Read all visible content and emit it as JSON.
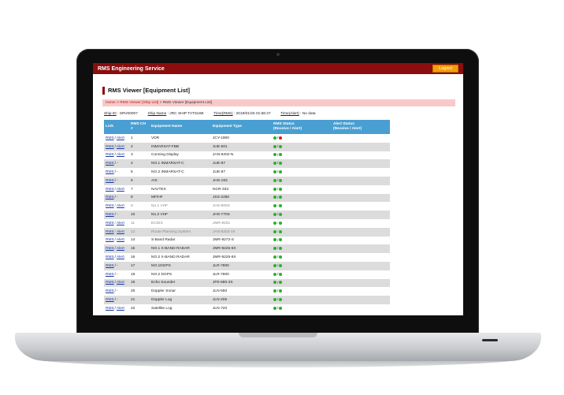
{
  "header": {
    "app_title": "RMS Engineering Service",
    "logout_label": "Logout"
  },
  "page": {
    "title": "RMS Viewer [Equipment List]"
  },
  "breadcrumb": {
    "home": "Home",
    "sep": ">",
    "ship_list": "RMS Viewer [Ship List]",
    "current": "RMS Viewer [Equipment List]"
  },
  "info": {
    "ship_id_label": "Ship ID",
    "ship_id_value": ": SRV00007",
    "ship_name_label": "Ship Name",
    "ship_name_value": ": JRC SHIP TATSUMI",
    "time_rms_label": "Time(RMS)",
    "time_rms_value": ": 2019/01/25 01:56:47",
    "time_alert_label": "Time(Alert)",
    "time_alert_value": ": No data"
  },
  "table": {
    "headers": {
      "link": "Link",
      "ch": "RMS CH #",
      "name": "Equipment Name",
      "type": "Equipment Type",
      "rms_status": "RMS Status",
      "rms_status_sub": "(Receive / Alert)",
      "alert_status": "Alert Status",
      "alert_status_sub": "(Receive / Alert)"
    },
    "link_rms": "RMS",
    "link_sep": "/",
    "link_alert": "Alert",
    "link_dash": "-",
    "rows": [
      {
        "ch": "1",
        "name": "VDR",
        "type": "JCY-1900",
        "alert": true,
        "alt": false,
        "dim": false,
        "s2": "red"
      },
      {
        "ch": "2",
        "name": "INMARSAT-FBB",
        "type": "JUE-501",
        "alert": true,
        "alt": true,
        "dim": false,
        "s2": "green"
      },
      {
        "ch": "3",
        "name": "Conning Display",
        "type": "JAN-9202-N",
        "alert": true,
        "alt": false,
        "dim": false,
        "s2": "green"
      },
      {
        "ch": "4",
        "name": "NO.1 INMARSAT-C",
        "type": "JUE-87",
        "alert": false,
        "alt": true,
        "dim": false,
        "s2": "green"
      },
      {
        "ch": "5",
        "name": "NO.2 INMARSAT-C",
        "type": "JUE-87",
        "alert": false,
        "alt": false,
        "dim": false,
        "s2": "green"
      },
      {
        "ch": "6",
        "name": "AIS",
        "type": "JHS-183",
        "alert": false,
        "alt": true,
        "dim": false,
        "s2": "green"
      },
      {
        "ch": "7",
        "name": "NAVTEX",
        "type": "NCR-333",
        "alert": true,
        "alt": false,
        "dim": false,
        "s2": "green"
      },
      {
        "ch": "8",
        "name": "MF/HF",
        "type": "JSS-2250",
        "alert": false,
        "alt": true,
        "dim": false,
        "s2": "green"
      },
      {
        "ch": "9",
        "name": "No.1 VHF",
        "type": "JHS-800S",
        "alert": true,
        "alt": false,
        "dim": true,
        "s2": "green"
      },
      {
        "ch": "10",
        "name": "No.2 VHF",
        "type": "JHS-770S",
        "alert": false,
        "alt": true,
        "dim": false,
        "s2": "green"
      },
      {
        "ch": "11",
        "name": "ECDIS",
        "type": "JMR-9201",
        "alert": true,
        "alt": false,
        "dim": true,
        "s2": "green"
      },
      {
        "ch": "12",
        "name": "Route Planning System",
        "type": "JAN-5203-19",
        "alert": true,
        "alt": true,
        "dim": true,
        "s2": "green"
      },
      {
        "ch": "14",
        "name": "S-Band Radar",
        "type": "JMR-9272-S",
        "alert": true,
        "alt": false,
        "dim": false,
        "s2": "green"
      },
      {
        "ch": "15",
        "name": "NO.1 X-BAND RADAR",
        "type": "JMR-9225-6X",
        "alert": true,
        "alt": true,
        "dim": false,
        "s2": "green"
      },
      {
        "ch": "16",
        "name": "NO.2 X-BAND RADAR",
        "type": "JMR-9225-6X",
        "alert": true,
        "alt": false,
        "dim": false,
        "s2": "green"
      },
      {
        "ch": "17",
        "name": "NO.1DGPS",
        "type": "JLR-7800",
        "alert": false,
        "alt": true,
        "dim": false,
        "s2": "green"
      },
      {
        "ch": "18",
        "name": "NO.2 DGPS",
        "type": "JLR-7800",
        "alert": false,
        "alt": false,
        "dim": false,
        "s2": "green"
      },
      {
        "ch": "19",
        "name": "Echo Sounder",
        "type": "JFE-680-2S",
        "alert": true,
        "alt": true,
        "dim": false,
        "s2": "green"
      },
      {
        "ch": "20",
        "name": "Doppler Sonar",
        "type": "JLN-550",
        "alert": false,
        "alt": false,
        "dim": false,
        "s2": "green"
      },
      {
        "ch": "21",
        "name": "Doppler Log",
        "type": "JLN-205",
        "alert": false,
        "alt": true,
        "dim": false,
        "s2": "green"
      },
      {
        "ch": "22",
        "name": "Satellite Log",
        "type": "JLN-720",
        "alert": true,
        "alt": false,
        "dim": false,
        "s2": "green"
      }
    ]
  },
  "colors": {
    "header_bg": "#8b0d0d",
    "logout_bg": "#f2a008",
    "table_header": "#4a9fd2",
    "ok": "#2bb12b",
    "error": "#d41c1c"
  }
}
